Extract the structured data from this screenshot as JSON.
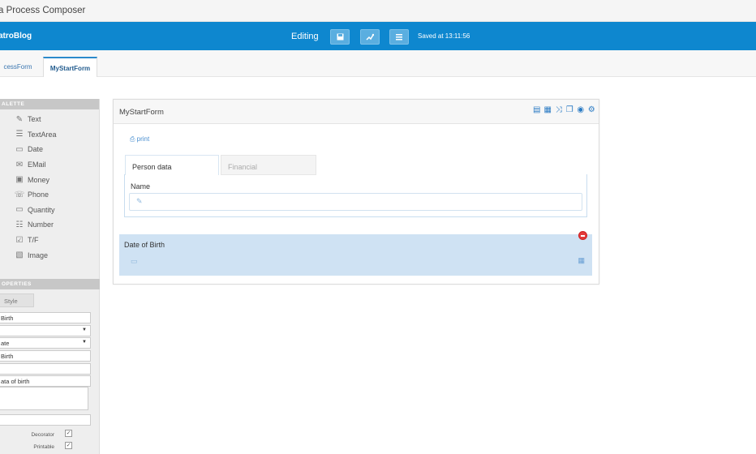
{
  "window": {
    "title": "a Process Composer"
  },
  "topbar": {
    "brand": "atroBlog",
    "editing_label": "Editing",
    "saved_text": "Saved at 13:11:56",
    "buttons": [
      "save-icon",
      "share-icon",
      "list-icon"
    ]
  },
  "page_tabs": [
    {
      "label": "cessForm",
      "active": false
    },
    {
      "label": "MyStartForm",
      "active": true
    }
  ],
  "palette": {
    "header": "ALETTE",
    "items": [
      {
        "label": "Text",
        "icon": "edit-icon",
        "glyph": "✎"
      },
      {
        "label": "TextArea",
        "icon": "textarea-icon",
        "glyph": "☰"
      },
      {
        "label": "Date",
        "icon": "calendar-icon",
        "glyph": "▭"
      },
      {
        "label": "EMail",
        "icon": "envelope-icon",
        "glyph": "✉"
      },
      {
        "label": "Money",
        "icon": "money-icon",
        "glyph": "▣"
      },
      {
        "label": "Phone",
        "icon": "phone-icon",
        "glyph": "☏"
      },
      {
        "label": "Quantity",
        "icon": "quantity-icon",
        "glyph": "▭"
      },
      {
        "label": "Number",
        "icon": "number-icon",
        "glyph": "☷"
      },
      {
        "label": "T/F",
        "icon": "checkbox-icon",
        "glyph": "☑"
      },
      {
        "label": "Image",
        "icon": "image-icon",
        "glyph": "▧"
      }
    ]
  },
  "properties": {
    "header": "OPERTIES",
    "style_button": "Style",
    "fields": [
      {
        "value": "Birth",
        "select": false
      },
      {
        "value": "",
        "select": true
      },
      {
        "value": "ate",
        "select": true
      },
      {
        "value": "Birth",
        "select": false
      },
      {
        "value": "",
        "select": false
      },
      {
        "value": "ata of birth",
        "select": false
      }
    ],
    "checkboxes": [
      {
        "label": "Decorator",
        "checked": true
      },
      {
        "label": "Printable",
        "checked": true
      }
    ]
  },
  "form": {
    "title": "MyStartForm",
    "header_icons": [
      "table-icon",
      "grid-icon",
      "shuffle-icon",
      "copy-icon",
      "globe-icon",
      "settings-icon"
    ],
    "print_label": "print",
    "tabs": [
      {
        "label": "Person data",
        "active": true
      },
      {
        "label": "Financial",
        "active": false
      }
    ],
    "name_label": "Name",
    "dob_label": "Date of Birth"
  },
  "colors": {
    "accent": "#0e87cf",
    "selected_bg": "#cfe2f3",
    "remove": "#e33a3a"
  }
}
